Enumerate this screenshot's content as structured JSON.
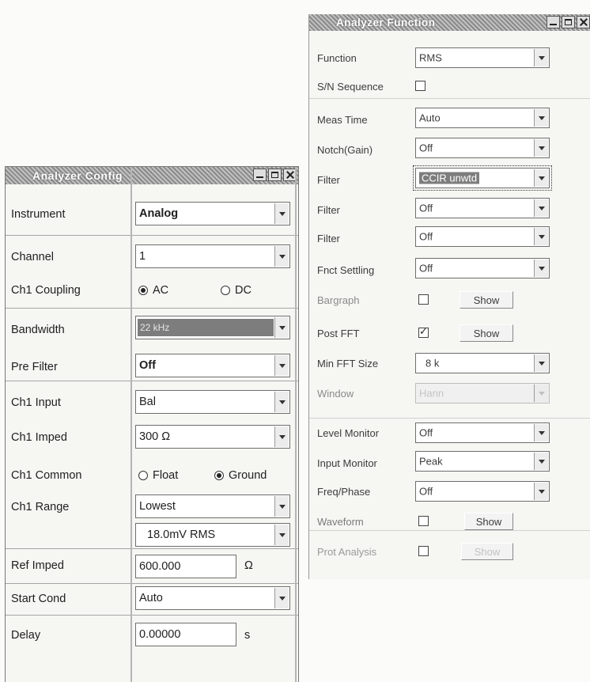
{
  "analyzer_config": {
    "title": "Analyzer Config",
    "instrument": {
      "label": "Instrument",
      "value": "Analog"
    },
    "channel": {
      "label": "Channel",
      "value": "1"
    },
    "ch1_coupling": {
      "label": "Ch1 Coupling",
      "options": [
        "AC",
        "DC"
      ],
      "selected": "AC"
    },
    "bandwidth": {
      "label": "Bandwidth",
      "value": "22 kHz"
    },
    "pre_filter": {
      "label": "Pre Filter",
      "value": "Off"
    },
    "ch1_input": {
      "label": "Ch1 Input",
      "value": "Bal"
    },
    "ch1_imped": {
      "label": "Ch1 Imped",
      "value": "300 Ω"
    },
    "ch1_common": {
      "label": "Ch1 Common",
      "options": [
        "Float",
        "Ground"
      ],
      "selected": "Ground"
    },
    "ch1_range": {
      "label": "Ch1 Range",
      "value": "Lowest",
      "sub_value": "18.0mV RMS"
    },
    "ref_imped": {
      "label": "Ref Imped",
      "value": "600.000",
      "unit": "Ω"
    },
    "start_cond": {
      "label": "Start Cond",
      "value": "Auto"
    },
    "delay": {
      "label": "Delay",
      "value": "0.00000",
      "unit": "s"
    }
  },
  "analyzer_function": {
    "title": "Analyzer Function",
    "function": {
      "label": "Function",
      "value": "RMS"
    },
    "sn_sequence": {
      "label": "S/N Sequence",
      "checked": false
    },
    "meas_time": {
      "label": "Meas Time",
      "value": "Auto"
    },
    "notch_gain": {
      "label": "Notch(Gain)",
      "value": "Off"
    },
    "filter1": {
      "label": "Filter",
      "value": "CCIR unwtd"
    },
    "filter2": {
      "label": "Filter",
      "value": "Off"
    },
    "filter3": {
      "label": "Filter",
      "value": "Off"
    },
    "fnct_settling": {
      "label": "Fnct Settling",
      "value": "Off"
    },
    "bargraph": {
      "label": "Bargraph",
      "checked": false,
      "button": "Show"
    },
    "post_fft": {
      "label": "Post FFT",
      "checked": true,
      "button": "Show"
    },
    "min_fft_size": {
      "label": "Min FFT Size",
      "value": "8 k"
    },
    "window": {
      "label": "Window",
      "value": "Hann"
    },
    "level_monitor": {
      "label": "Level Monitor",
      "value": "Off"
    },
    "input_monitor": {
      "label": "Input Monitor",
      "value": "Peak"
    },
    "freq_phase": {
      "label": "Freq/Phase",
      "value": "Off"
    },
    "waveform": {
      "label": "Waveform",
      "checked": false,
      "button": "Show"
    },
    "prot_analysis": {
      "label": "Prot Analysis",
      "checked": false,
      "button": "Show"
    }
  },
  "colors": {
    "title_bar": "#9a9a9a",
    "highlight": "#7d7d7d",
    "window_bg": "#f6f6f3"
  }
}
